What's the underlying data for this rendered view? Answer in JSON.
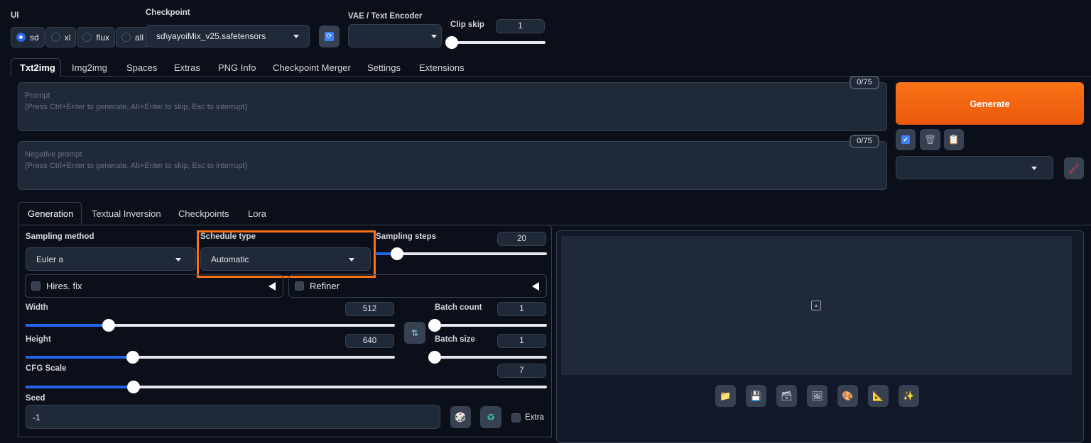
{
  "top": {
    "ui_label": "UI",
    "ui_options": [
      {
        "label": "sd",
        "selected": true
      },
      {
        "label": "xl",
        "selected": false
      },
      {
        "label": "flux",
        "selected": false
      },
      {
        "label": "all",
        "selected": false
      }
    ],
    "checkpoint_label": "Checkpoint",
    "checkpoint_value": "sd\\yayoiMix_v25.safetensors",
    "vae_label": "VAE / Text Encoder",
    "vae_value": "",
    "clip_skip_label": "Clip skip",
    "clip_skip_value": 1
  },
  "tabs": [
    "Txt2img",
    "Img2img",
    "Spaces",
    "Extras",
    "PNG Info",
    "Checkpoint Merger",
    "Settings",
    "Extensions"
  ],
  "active_tab": "Txt2img",
  "prompt": {
    "label": "Prompt",
    "placeholder": "(Press Ctrl+Enter to generate, Alt+Enter to skip, Esc to interrupt)",
    "counter": "0/75"
  },
  "negative_prompt": {
    "label": "Negative prompt",
    "placeholder": "(Press Ctrl+Enter to generate, Alt+Enter to skip, Esc to interrupt)",
    "counter": "0/75"
  },
  "generate_label": "Generate",
  "accent_color": "#f97316",
  "tool_icons": [
    "checkbox-icon",
    "trash-icon",
    "clipboard-icon"
  ],
  "styles_value": "",
  "subtabs": [
    "Generation",
    "Textual Inversion",
    "Checkpoints",
    "Lora"
  ],
  "active_subtab": "Generation",
  "generation": {
    "sampling_method_label": "Sampling method",
    "sampling_method": "Euler a",
    "schedule_type_label": "Schedule type",
    "schedule_type": "Automatic",
    "sampling_steps_label": "Sampling steps",
    "sampling_steps": 20,
    "hires_fix_label": "Hires. fix",
    "refiner_label": "Refiner",
    "width_label": "Width",
    "width": 512,
    "height_label": "Height",
    "height": 640,
    "batch_count_label": "Batch count",
    "batch_count": 1,
    "batch_size_label": "Batch size",
    "batch_size": 1,
    "cfg_label": "CFG Scale",
    "cfg": 7,
    "seed_label": "Seed",
    "seed": "-1",
    "extra_label": "Extra"
  },
  "output_icons": [
    "folder-icon",
    "save-icon",
    "zip-icon",
    "image-icon",
    "palette-icon",
    "ruler-icon",
    "sparkles-icon"
  ]
}
